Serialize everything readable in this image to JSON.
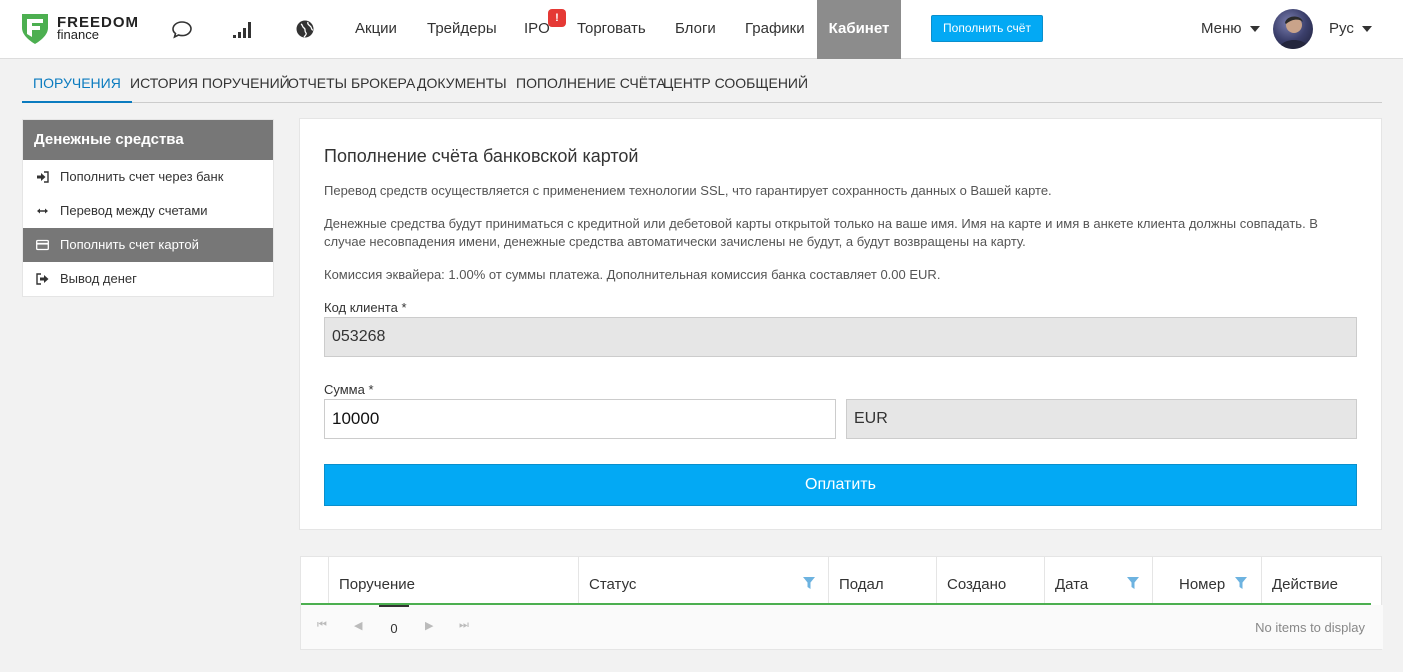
{
  "brand": {
    "name": "FREEDOM",
    "sub": "finance"
  },
  "colors": {
    "accent": "#03a9f4",
    "active_tab": "#8c8c8c",
    "badge": "#e53935",
    "link": "#0a7bbf"
  },
  "topnav": {
    "items": [
      "Акции",
      "Трейдеры",
      "IPO",
      "Торговать",
      "Блоги",
      "Графики",
      "Кабинет"
    ],
    "ipo_badge": "!",
    "fund_button": "Пополнить счёт",
    "menu": "Меню",
    "lang": "Рус",
    "icons": [
      "chat-bubble-icon",
      "signal-bars-icon",
      "globe-icon"
    ]
  },
  "subnav": {
    "items": [
      "ПОРУЧЕНИЯ",
      "ИСТОРИЯ ПОРУЧЕНИЙ",
      "ОТЧЕТЫ БРОКЕРА",
      "ДОКУМЕНТЫ",
      "ПОПОЛНЕНИЕ СЧЁТА",
      "ЦЕНТР СООБЩЕНИЙ"
    ],
    "active": 0
  },
  "sidebar": {
    "title": "Денежные средства",
    "items": [
      {
        "label": "Пополнить счет через банк",
        "icon": "sign-in-icon"
      },
      {
        "label": "Перевод между счетами",
        "icon": "arrows-horizontal-icon"
      },
      {
        "label": "Пополнить счет картой",
        "icon": "credit-card-icon"
      },
      {
        "label": "Вывод денег",
        "icon": "sign-out-icon"
      }
    ],
    "active": 2
  },
  "form": {
    "title": "Пополнение счёта банковской картой",
    "note1": "Перевод средств осуществляется с применением технологии SSL, что гарантирует сохранность данных о Вашей карте.",
    "note2": "Денежные средства будут приниматься с кредитной или дебетовой карты открытой только на ваше имя. Имя на карте и имя в анкете клиента должны совпадать. В случае несовпадения имени, денежные средства автоматически зачислены не будут, а будут возвращены на карту.",
    "note3": "Комиссия эквайера: 1.00% от суммы платежа. Дополнительная комиссия банка составляет 0.00 EUR.",
    "client_label": "Код клиента *",
    "client_value": "053268",
    "amount_label": "Сумма *",
    "amount_value": "10000",
    "currency": "EUR",
    "pay_button": "Оплатить"
  },
  "grid": {
    "columns": [
      "Поручение",
      "Статус",
      "Подал",
      "Создано",
      "Дата",
      "Номер",
      "Действие"
    ],
    "filterable": [
      "Статус",
      "Дата",
      "Номер"
    ],
    "page": "0",
    "empty": "No items to display"
  }
}
